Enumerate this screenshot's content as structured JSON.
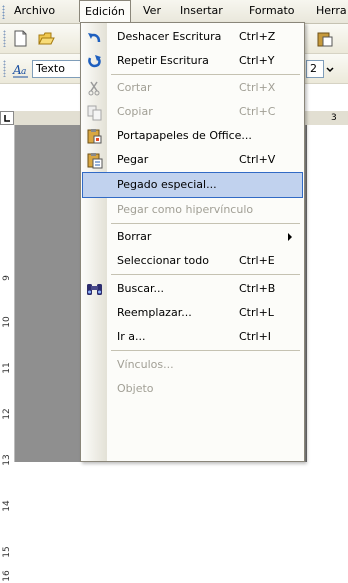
{
  "menubar": {
    "items": [
      {
        "label": "Archivo"
      },
      {
        "label": "Edición"
      },
      {
        "label": "Ver"
      },
      {
        "label": "Insertar"
      },
      {
        "label": "Formato"
      },
      {
        "label": "Herra"
      }
    ]
  },
  "toolbar2": {
    "style_box": "Texto",
    "size_box": "2",
    "ruler_mark": "3"
  },
  "ruler": {
    "numbers": [
      "9",
      "10",
      "11",
      "12",
      "13",
      "14",
      "15",
      "16"
    ]
  },
  "menu": {
    "items": [
      {
        "label": "Deshacer Escritura",
        "shortcut": "Ctrl+Z"
      },
      {
        "label": "Repetir Escritura",
        "shortcut": "Ctrl+Y"
      },
      {
        "label": "Cortar",
        "shortcut": "Ctrl+X"
      },
      {
        "label": "Copiar",
        "shortcut": "Ctrl+C"
      },
      {
        "label": "Portapapeles de Office...",
        "shortcut": ""
      },
      {
        "label": "Pegar",
        "shortcut": "Ctrl+V"
      },
      {
        "label": "Pegado especial...",
        "shortcut": ""
      },
      {
        "label": "Pegar como hipervínculo",
        "shortcut": ""
      },
      {
        "label": "Borrar",
        "shortcut": ""
      },
      {
        "label": "Seleccionar todo",
        "shortcut": "Ctrl+E"
      },
      {
        "label": "Buscar...",
        "shortcut": "Ctrl+B"
      },
      {
        "label": "Reemplazar...",
        "shortcut": "Ctrl+L"
      },
      {
        "label": "Ir a...",
        "shortcut": "Ctrl+I"
      },
      {
        "label": "Vínculos...",
        "shortcut": ""
      },
      {
        "label": "Objeto",
        "shortcut": ""
      }
    ]
  },
  "colors": {
    "highlight": "#c1d2ee",
    "highlight_border": "#316ac5",
    "disabled_text": "#a19f95"
  }
}
